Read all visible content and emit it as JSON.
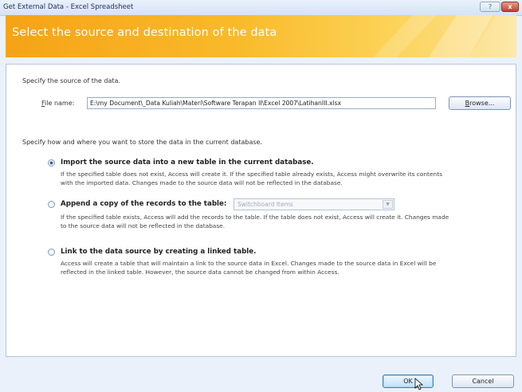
{
  "window": {
    "title": "Get External Data - Excel Spreadsheet",
    "help_label": "?",
    "close_label": "x"
  },
  "banner": {
    "title": "Select the source and destination of the data"
  },
  "source": {
    "instruction": "Specify the source of the data.",
    "file_label": "File name:",
    "file_value": "E:\\my Document\\_Data Kuliah\\Materi\\Software Terapan II\\Excel 2007\\LatihanIII.xlsx",
    "browse_label": "Browse..."
  },
  "destination": {
    "instruction": "Specify how and where you want to store the data in the current database.",
    "options": [
      {
        "title": "Import the source data into a new table in the current database.",
        "selected": true,
        "desc1": "If the specified table does not exist, Access will create it. If the specified table already exists, Access might overwrite its contents",
        "desc2": "with the imported data. Changes made to the source data will not be reflected in the database."
      },
      {
        "title": "Append a copy of the records to the table:",
        "selected": false,
        "table_value": "Switchboard Items",
        "desc1": "If the specified table exists, Access will add the records to the table. If the table does not exist, Access will create it. Changes made",
        "desc2": "to the source data will not be reflected in the database."
      },
      {
        "title": "Link to the data source by creating a linked table.",
        "selected": false,
        "desc1": "Access will create a table that will maintain a link to the source data in Excel. Changes made to the source data in Excel will be",
        "desc2": "reflected in the linked table. However, the source data cannot be changed from within Access."
      }
    ]
  },
  "footer": {
    "ok_label": "OK",
    "cancel_label": "Cancel"
  },
  "colors": {
    "banner_start": "#f6a316",
    "banner_end": "#fde49a",
    "panel_bg": "#ffffff",
    "window_bg": "#eaf1fb"
  }
}
